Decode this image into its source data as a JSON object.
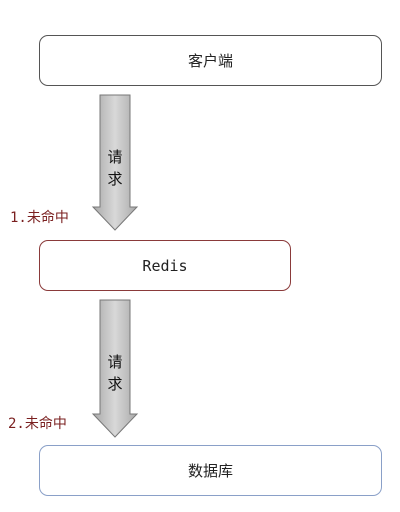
{
  "nodes": {
    "client": "客户端",
    "redis": "Redis",
    "database": "数据库"
  },
  "arrows": {
    "first": {
      "label_top": "请",
      "label_bottom": "求",
      "note": "1.未命中"
    },
    "second": {
      "label_top": "请",
      "label_bottom": "求",
      "note": "2.未命中"
    }
  }
}
